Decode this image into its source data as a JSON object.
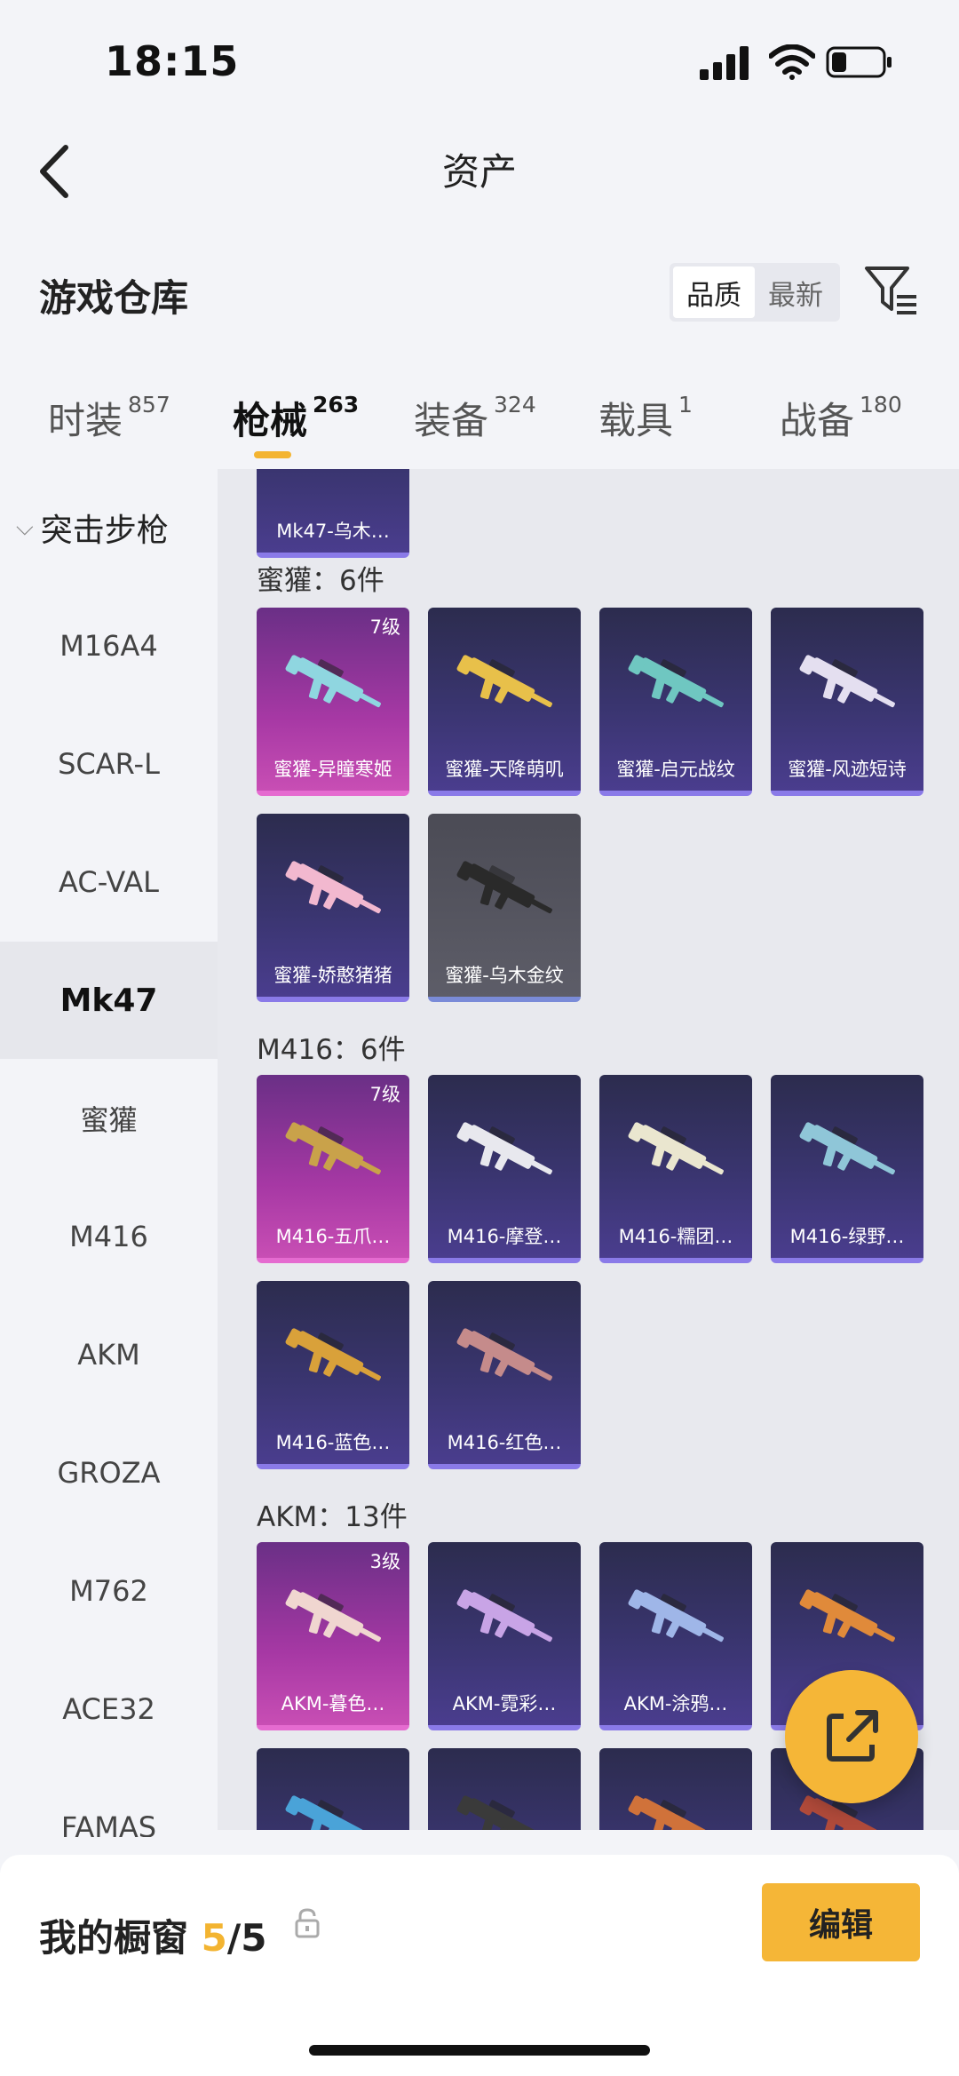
{
  "status": {
    "time": "18:15"
  },
  "nav": {
    "title": "资产"
  },
  "warehouse": {
    "title": "游戏仓库",
    "sort": [
      "品质",
      "最新"
    ]
  },
  "tabs": [
    {
      "label": "时装",
      "count": "857"
    },
    {
      "label": "枪械",
      "count": "263"
    },
    {
      "label": "装备",
      "count": "324"
    },
    {
      "label": "载具",
      "count": "1"
    },
    {
      "label": "战备",
      "count": "180"
    }
  ],
  "sidebar": {
    "category": "突击步枪",
    "items": [
      "M16A4",
      "SCAR-L",
      "AC-VAL",
      "Mk47",
      "蜜獾",
      "M416",
      "AKM",
      "GROZA",
      "M762",
      "ACE32",
      "FAMAS"
    ],
    "selected": "Mk47"
  },
  "content": {
    "partial_top": "Mk47-乌木…",
    "sections": [
      {
        "title": "蜜獾：6件",
        "cards": [
          {
            "name": "蜜獾-异瞳寒姬",
            "level": "7级",
            "style": "pink",
            "gun": "#8fd6e0"
          },
          {
            "name": "蜜獾-天降萌叽",
            "level": "",
            "style": "dark",
            "gun": "#e8c04a"
          },
          {
            "name": "蜜獾-启元战纹",
            "level": "",
            "style": "dark",
            "gun": "#6fc7c1"
          },
          {
            "name": "蜜獾-风迹短诗",
            "level": "",
            "style": "dark",
            "gun": "#e4dff0"
          },
          {
            "name": "蜜獾-娇憨猪猪",
            "level": "",
            "style": "dark",
            "gun": "#f2b8cf"
          },
          {
            "name": "蜜獾-乌木金纹",
            "level": "",
            "style": "gray",
            "gun": "#2a2a2a"
          }
        ]
      },
      {
        "title": "M416：6件",
        "cards": [
          {
            "name": "M416-五爪…",
            "level": "7级",
            "style": "pink",
            "gun": "#c9a24a"
          },
          {
            "name": "M416-摩登…",
            "level": "",
            "style": "dark",
            "gun": "#e8e8ee"
          },
          {
            "name": "M416-糯团…",
            "level": "",
            "style": "dark",
            "gun": "#eae6cf"
          },
          {
            "name": "M416-绿野…",
            "level": "",
            "style": "dark",
            "gun": "#8fc6d8"
          },
          {
            "name": "M416-蓝色…",
            "level": "",
            "style": "dark",
            "gun": "#d9a13a"
          },
          {
            "name": "M416-红色…",
            "level": "",
            "style": "dark",
            "gun": "#c58b8b"
          }
        ]
      },
      {
        "title": "AKM：13件",
        "cards": [
          {
            "name": "AKM-暮色…",
            "level": "3级",
            "style": "pink",
            "gun": "#f0d6d0"
          },
          {
            "name": "AKM-霓彩…",
            "level": "",
            "style": "dark",
            "gun": "#c8a4e6"
          },
          {
            "name": "AKM-涂鸦…",
            "level": "",
            "style": "dark",
            "gun": "#9fb6e8"
          },
          {
            "name": "",
            "level": "",
            "style": "dark",
            "gun": "#e08a3a"
          },
          {
            "name": "",
            "level": "",
            "style": "dark",
            "gun": "#4aa3d8"
          },
          {
            "name": "",
            "level": "",
            "style": "dark",
            "gun": "#3a3a3a"
          },
          {
            "name": "",
            "level": "",
            "style": "dark",
            "gun": "#d0723a"
          },
          {
            "name": "",
            "level": "",
            "style": "dark",
            "gun": "#b04a3a"
          }
        ]
      }
    ]
  },
  "bottom": {
    "label": "我的橱窗",
    "count_current": "5",
    "count_total": "/5",
    "edit_label": "编辑"
  },
  "colors": {
    "accent": "#f5b637",
    "rare": "#a638a4",
    "normal": "#3a3570"
  }
}
